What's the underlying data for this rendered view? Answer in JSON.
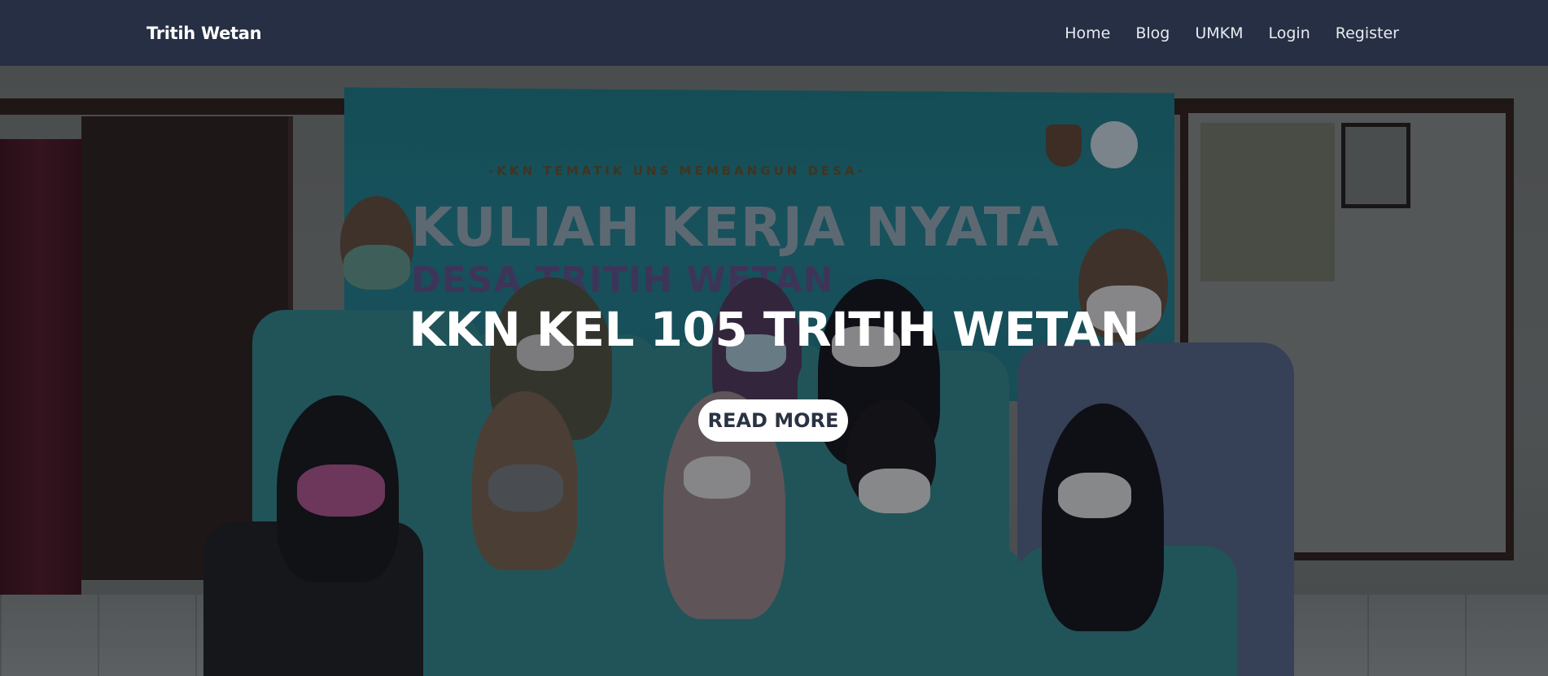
{
  "navbar": {
    "brand": "Tritih Wetan",
    "links": [
      {
        "label": "Home"
      },
      {
        "label": "Blog"
      },
      {
        "label": "UMKM"
      },
      {
        "label": "Login"
      },
      {
        "label": "Register"
      }
    ]
  },
  "hero": {
    "title": "KKN KEL 105 TRITIH WETAN",
    "button_label": "READ MORE",
    "photo": {
      "banner_subtitle": "-KKN TEMATIK UNS MEMBANGUN DESA-",
      "banner_title": "KULIAH KERJA NYATA",
      "banner_line2": "DESA TRITIH WETAN"
    }
  },
  "colors": {
    "navbar_bg": "#262f43",
    "button_bg": "#ffffff",
    "button_text": "#2a3344",
    "hero_title": "#ffffff"
  }
}
